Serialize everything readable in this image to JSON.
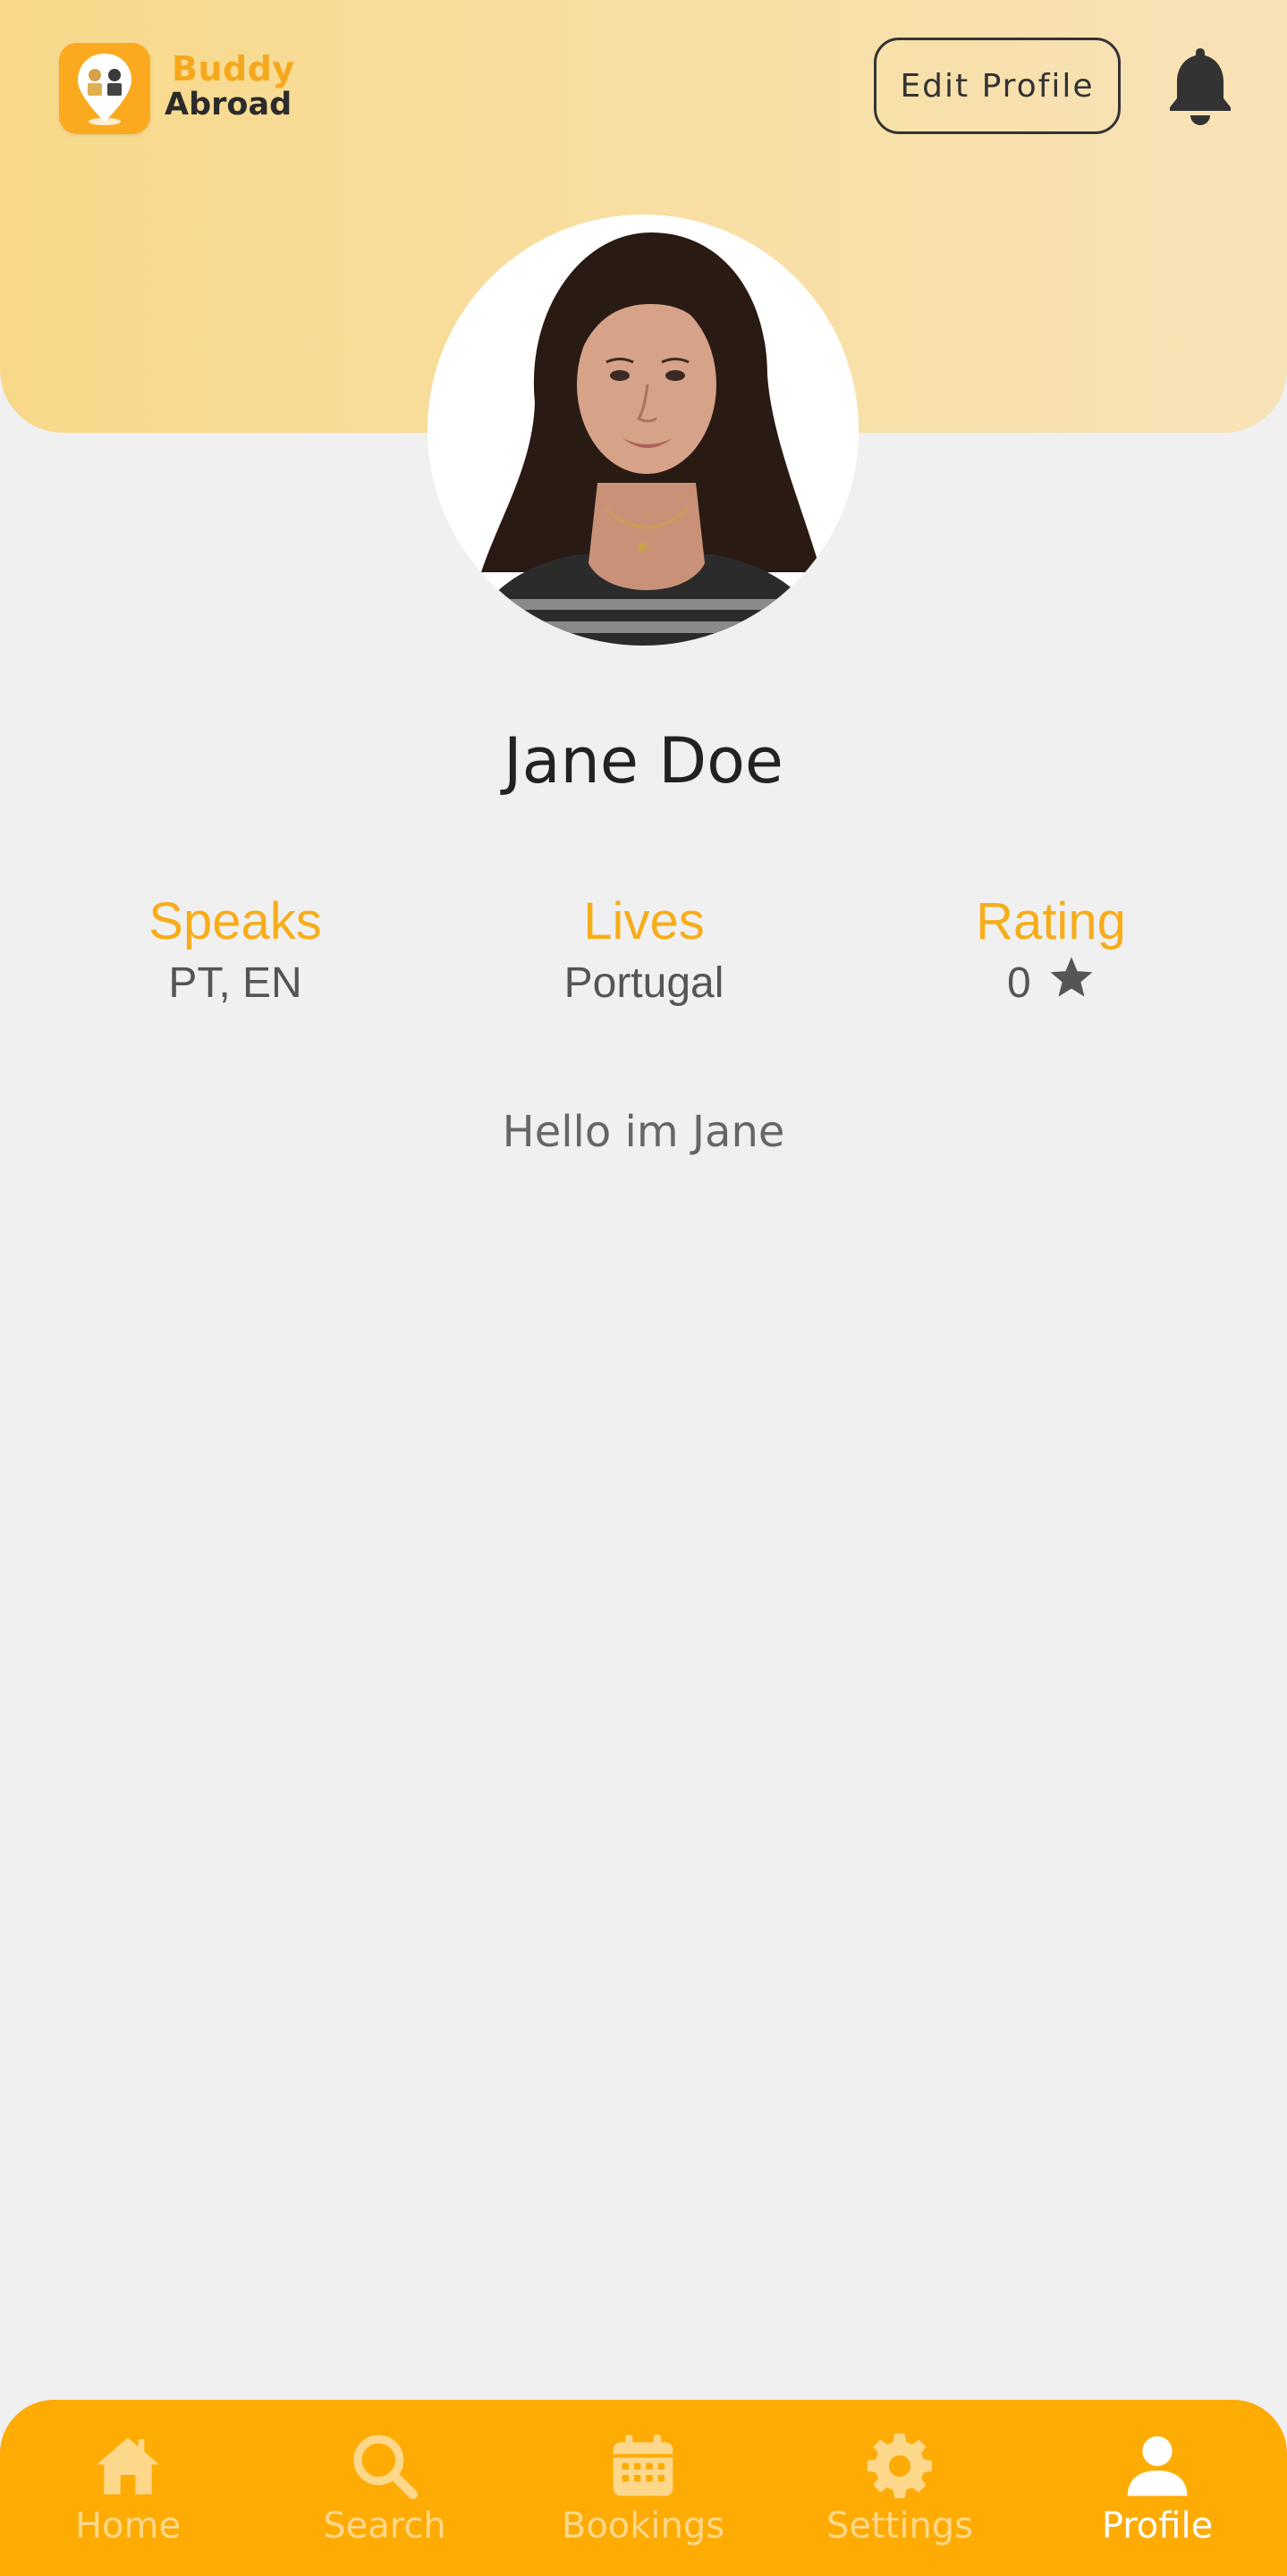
{
  "app": {
    "brand_line1": "Buddy",
    "brand_line2": "Abroad"
  },
  "header": {
    "edit_label": "Edit Profile",
    "bell_icon": "bell-icon"
  },
  "profile": {
    "name": "Jane Doe",
    "bio": "Hello im Jane",
    "stats": [
      {
        "label": "Speaks",
        "value": "PT, EN"
      },
      {
        "label": "Lives",
        "value": "Portugal"
      },
      {
        "label": "Rating",
        "value": "0",
        "icon": "star-icon"
      }
    ]
  },
  "nav": {
    "items": [
      {
        "label": "Home",
        "icon": "home-icon"
      },
      {
        "label": "Search",
        "icon": "search-icon"
      },
      {
        "label": "Bookings",
        "icon": "calendar-icon"
      },
      {
        "label": "Settings",
        "icon": "gear-icon"
      },
      {
        "label": "Profile",
        "icon": "user-icon",
        "active": true
      }
    ]
  },
  "colors": {
    "accent": "#f7ad1a",
    "nav_bg": "#feab04",
    "header_bg": "#f8d98a",
    "page_bg": "#f0f0f0"
  }
}
